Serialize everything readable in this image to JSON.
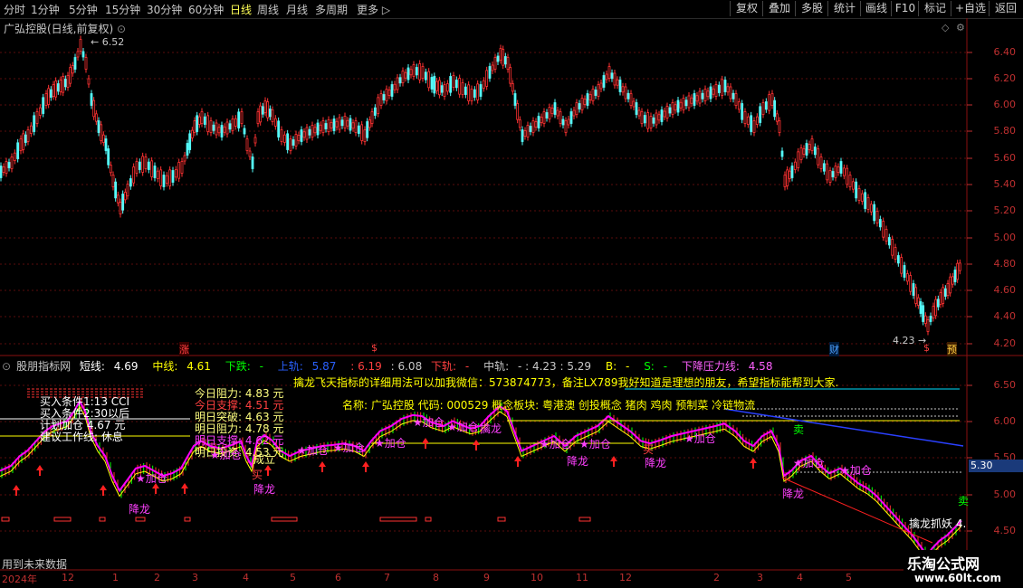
{
  "toolbar": {
    "timeframes": [
      "分时",
      "1分钟",
      "5分钟",
      "15分钟",
      "30分钟",
      "60分钟",
      "日线",
      "周线",
      "月线",
      "多周期",
      "更多 ▷"
    ],
    "active_timeframe": "日线",
    "right_buttons": [
      "复权",
      "叠加",
      "多股",
      "统计",
      "画线",
      "F10",
      "标记",
      "+自选",
      "返回"
    ]
  },
  "main_chart": {
    "title": "广弘控股(日线,前复权)",
    "price_axis": [
      "6.40",
      "6.20",
      "6.00",
      "5.80",
      "5.60",
      "5.40",
      "5.20",
      "5.00",
      "4.80",
      "4.60",
      "4.40",
      "4.20"
    ],
    "high_label": "6.52",
    "low_label": "4.23",
    "markers": {
      "zhang": "涨",
      "dollar1": "$",
      "cai": "财",
      "dollar2": "$",
      "yu": "预"
    }
  },
  "indicator": {
    "name": "股朋指标网",
    "short_line_label": "短线:",
    "short_line_value": "4.69",
    "mid_line_label": "中线:",
    "mid_line_value": "4.61",
    "down_label": "下跌:",
    "down_value": "-",
    "upper_label": "上轨:",
    "upper_value": "5.87",
    "v1": ": 6.19",
    "v2": ": 6.08",
    "lower_label": "下轨:",
    "lower_value": "-",
    "middle_label": "中轨:",
    "middle_value": "- : 4.23 : 5.29",
    "b_label": "B:",
    "b_value": "-",
    "s_label": "S:",
    "s_value": "-",
    "pressure_label": "下降压力线:",
    "pressure_value": "4.58",
    "axis": [
      "6.50",
      "6.00",
      "5.50",
      "5.00",
      "4.50"
    ],
    "axis_highlight": "5.30",
    "notice": "擒龙飞天指标的详细用法可以加我微信：573874773，备注LX789我好知道是理想的朋友，希望指标能帮到大家.",
    "stock_info": "名称: 广弘控股 代码: 000529 概念板块: 粤港澳 创投概念 猪肉 鸡肉 预制菜 冷链物流",
    "left_labels": {
      "buy_cond1": "买入条件1:13 CCI",
      "buy_cond2": "买入条件2:30以后",
      "capital": "计划加仓 4.67 元",
      "work": "建议工作线: 休息",
      "resist": "今日阻力:",
      "resist_val": "4.83 元",
      "support": "今日支撑:",
      "support_val": "4.51 元",
      "breakout": "明日突破:",
      "breakout_val": "4.63 元",
      "tmr_resist": "明日阻力:",
      "tmr_resist_val": "4.78 元",
      "tmr_support": "明日支撑:",
      "tmr_support_val": "4.62 元",
      "invest": "明日投资:",
      "invest_val": "4.53 元"
    },
    "signals": {
      "add": "★加仓",
      "dragon": "降龙",
      "buy": "买",
      "sell": "卖",
      "done": "成立",
      "qinlong": "擒龙抓妖 4.",
      "qinglong2": "擒龙"
    }
  },
  "status_text": "用到未来数据",
  "x_axis": {
    "labels": [
      "2024年",
      "12",
      "1",
      "2",
      "3",
      "4",
      "5",
      "6",
      "7",
      "8",
      "9",
      "10",
      "11",
      "12",
      "2",
      "3",
      "4",
      "5"
    ],
    "year": "2024年"
  },
  "watermark": {
    "line1": "乐淘公式网",
    "line2": "www.60lt.com"
  },
  "colors": {
    "up": "#ff3232",
    "down": "#54fcfc",
    "grid": "#6a0f0f",
    "yellow": "#ffff00",
    "magenta": "#ff00ff",
    "cyan": "#00e0ff",
    "green": "#00ff00"
  }
}
